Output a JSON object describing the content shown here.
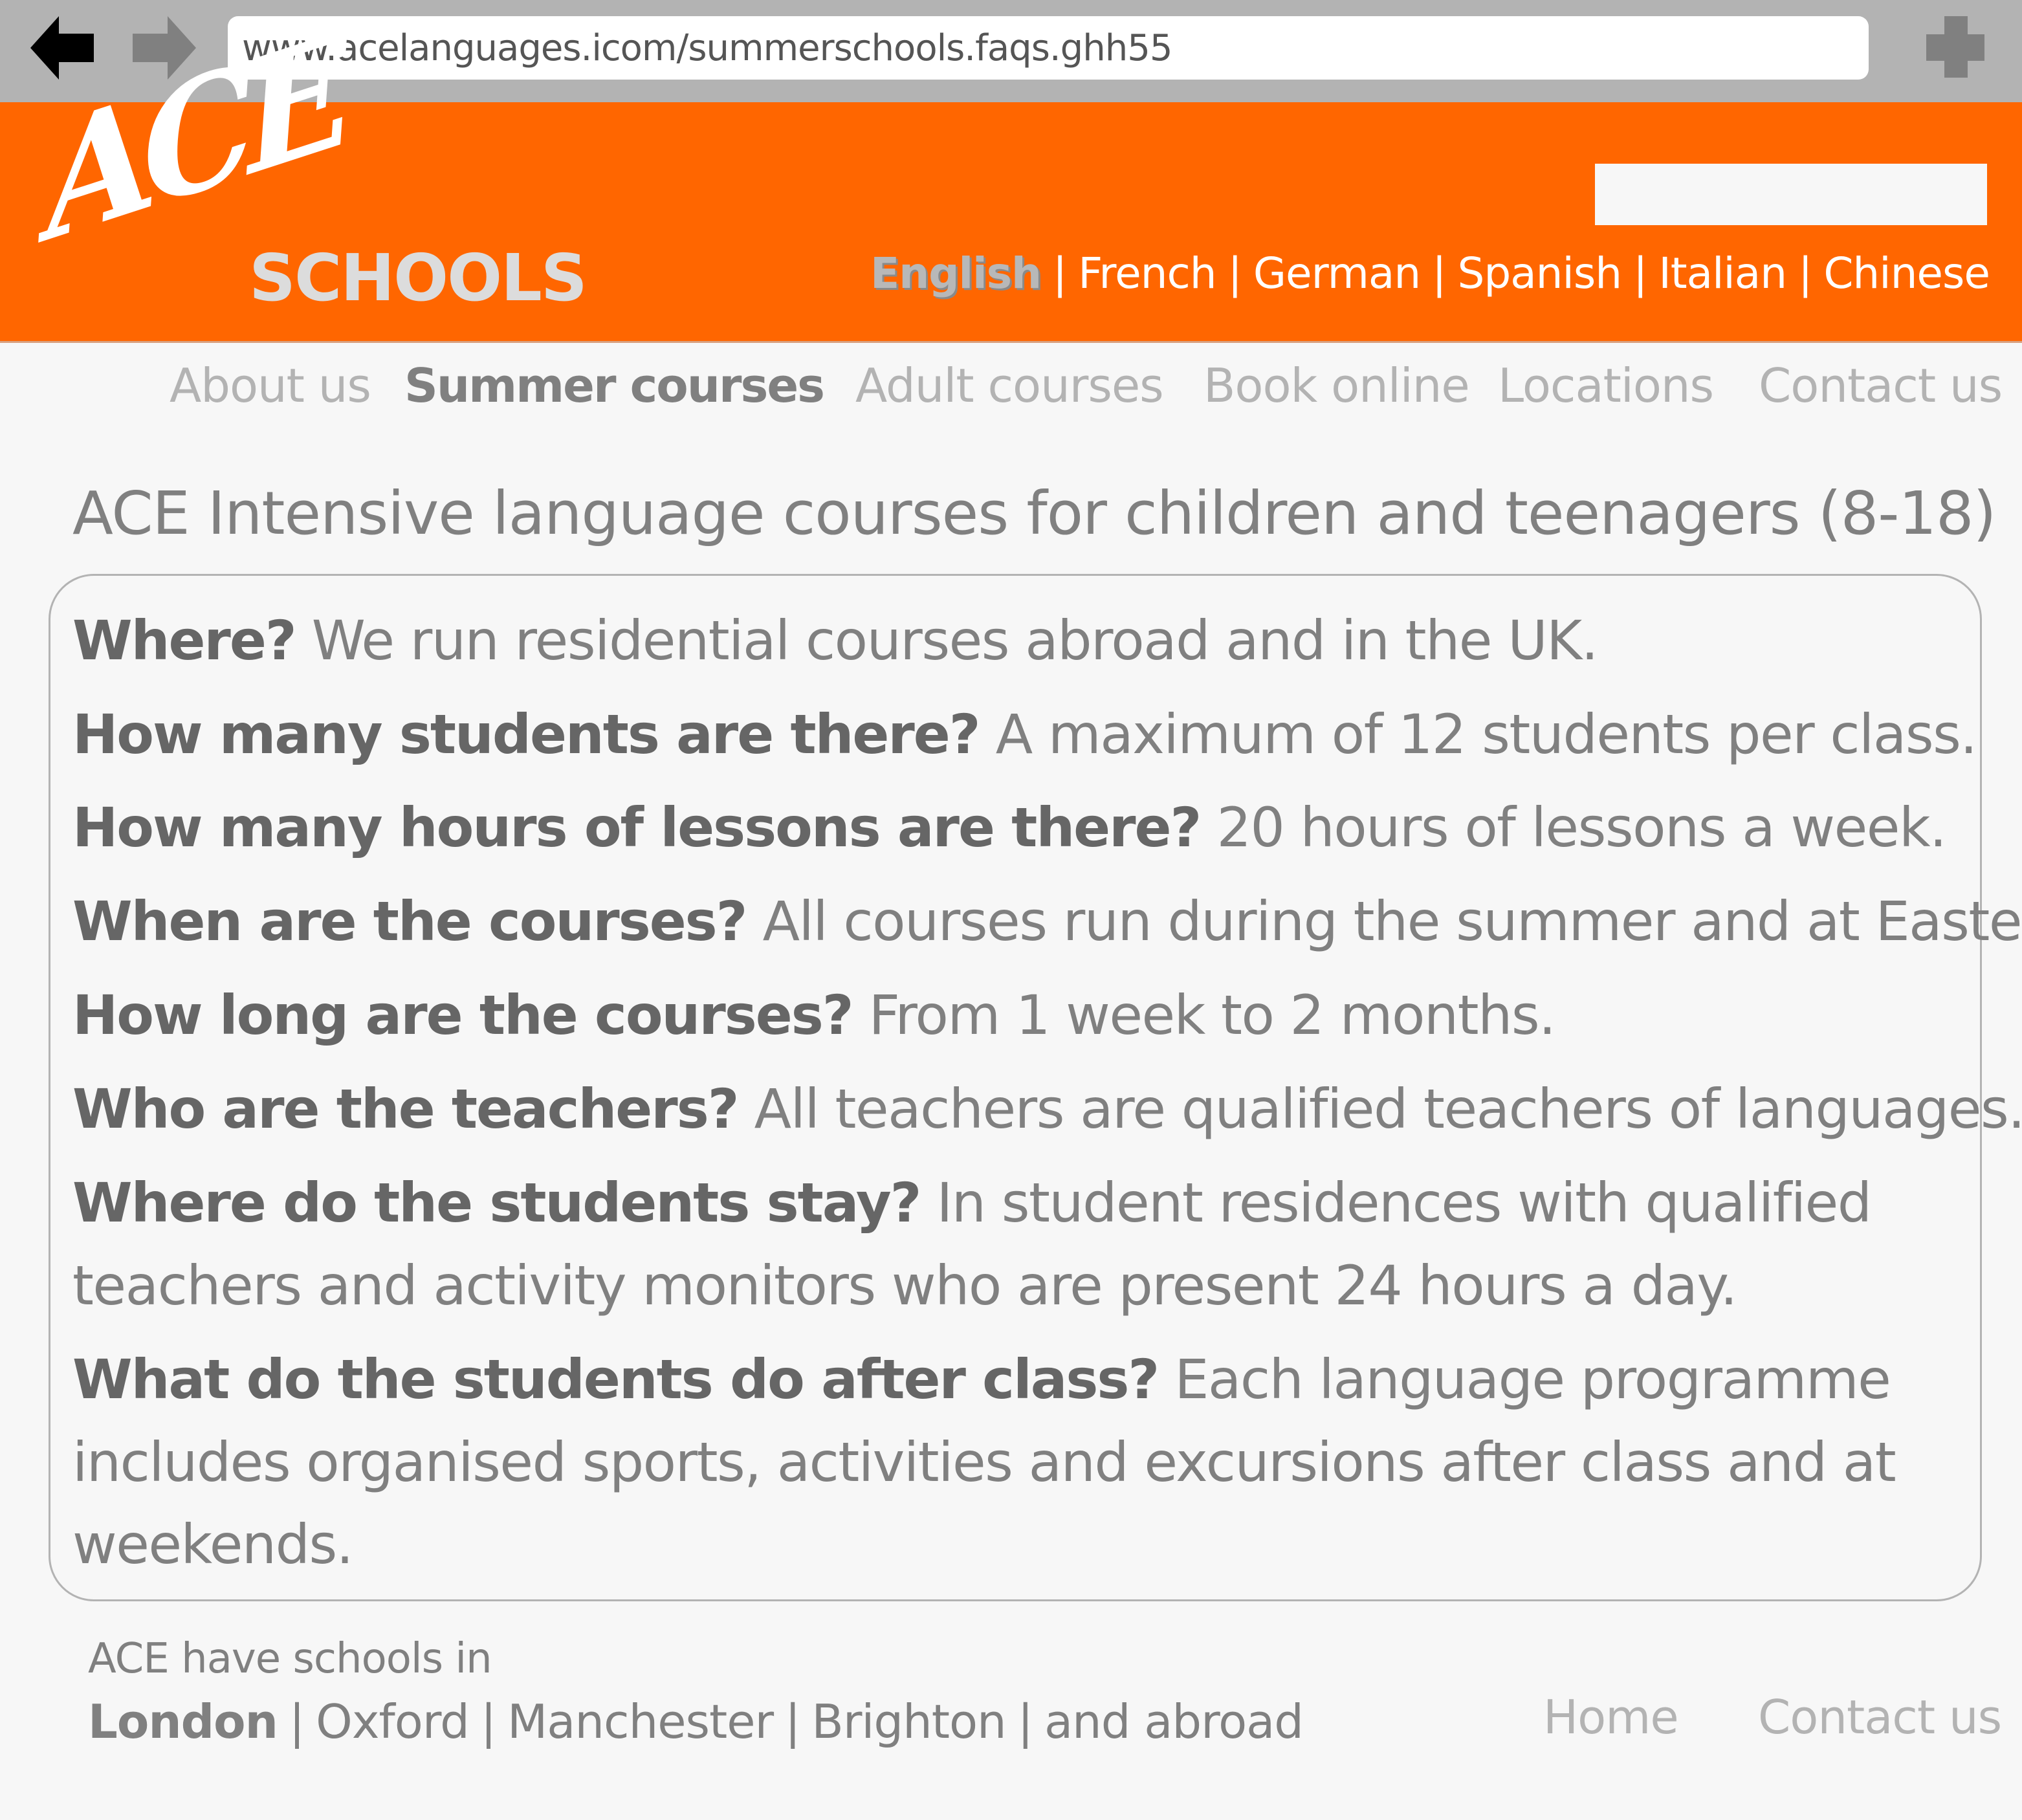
{
  "browser": {
    "back_icon": "back-arrow-icon",
    "forward_icon": "forward-arrow-icon",
    "url": "www.acelanguages.icom/summerschools.faqs.ghh55",
    "new_tab_icon": "plus-icon"
  },
  "colors": {
    "brand_orange": "#ff6600",
    "chrome_gray": "#b3b3b3",
    "text_dark": "#666666",
    "text_mid": "#808080",
    "text_light": "#b3b3b3"
  },
  "header": {
    "logo_main": "ACE",
    "logo_sub": "SCHOOLS",
    "search_value": "",
    "languages": [
      {
        "label": "English",
        "active": true
      },
      {
        "label": "French",
        "active": false
      },
      {
        "label": "German",
        "active": false
      },
      {
        "label": "Spanish",
        "active": false
      },
      {
        "label": "Italian",
        "active": false
      },
      {
        "label": "Chinese",
        "active": false
      }
    ],
    "separator": "|"
  },
  "nav": {
    "items": [
      {
        "label": "About us",
        "active": false
      },
      {
        "label": "Summer courses",
        "active": true
      },
      {
        "label": "Adult courses",
        "active": false
      },
      {
        "label": "Book online",
        "active": false
      },
      {
        "label": "Locations",
        "active": false
      },
      {
        "label": "Contact us",
        "active": false
      }
    ]
  },
  "page": {
    "title": "ACE Intensive language courses for children and teenagers (8-18)"
  },
  "faq": [
    {
      "question": "Where?",
      "answer": "We run residential courses abroad and in the UK."
    },
    {
      "question": "How many students are there?",
      "answer": "A maximum of 12 students per class."
    },
    {
      "question": "How many hours of lessons are there?",
      "answer": "20 hours of lessons a week."
    },
    {
      "question": "When are the courses?",
      "answer": "All courses run during the summer and at Easter."
    },
    {
      "question": "How long are the courses?",
      "answer": "From 1 week to 2 months."
    },
    {
      "question": "Who are the teachers?",
      "answer": "All teachers are qualified teachers of languages."
    },
    {
      "question": "Where do the students stay?",
      "answer": "In student residences with qualified",
      "answer_cont": [
        "teachers and activity monitors who are present 24 hours a day."
      ]
    },
    {
      "question": "What do the students do after class?",
      "answer": "Each language programme",
      "answer_cont": [
        "includes organised sports, activities and excursions after class and at",
        "weekends."
      ]
    }
  ],
  "footer": {
    "intro": "ACE have schools in",
    "cities": [
      {
        "label": "London",
        "active": true
      },
      {
        "label": "Oxford",
        "active": false
      },
      {
        "label": "Manchester",
        "active": false
      },
      {
        "label": "Brighton",
        "active": false
      },
      {
        "label": "and abroad",
        "active": false
      }
    ],
    "separator": "|",
    "home_label": "Home",
    "contact_label": "Contact us"
  }
}
